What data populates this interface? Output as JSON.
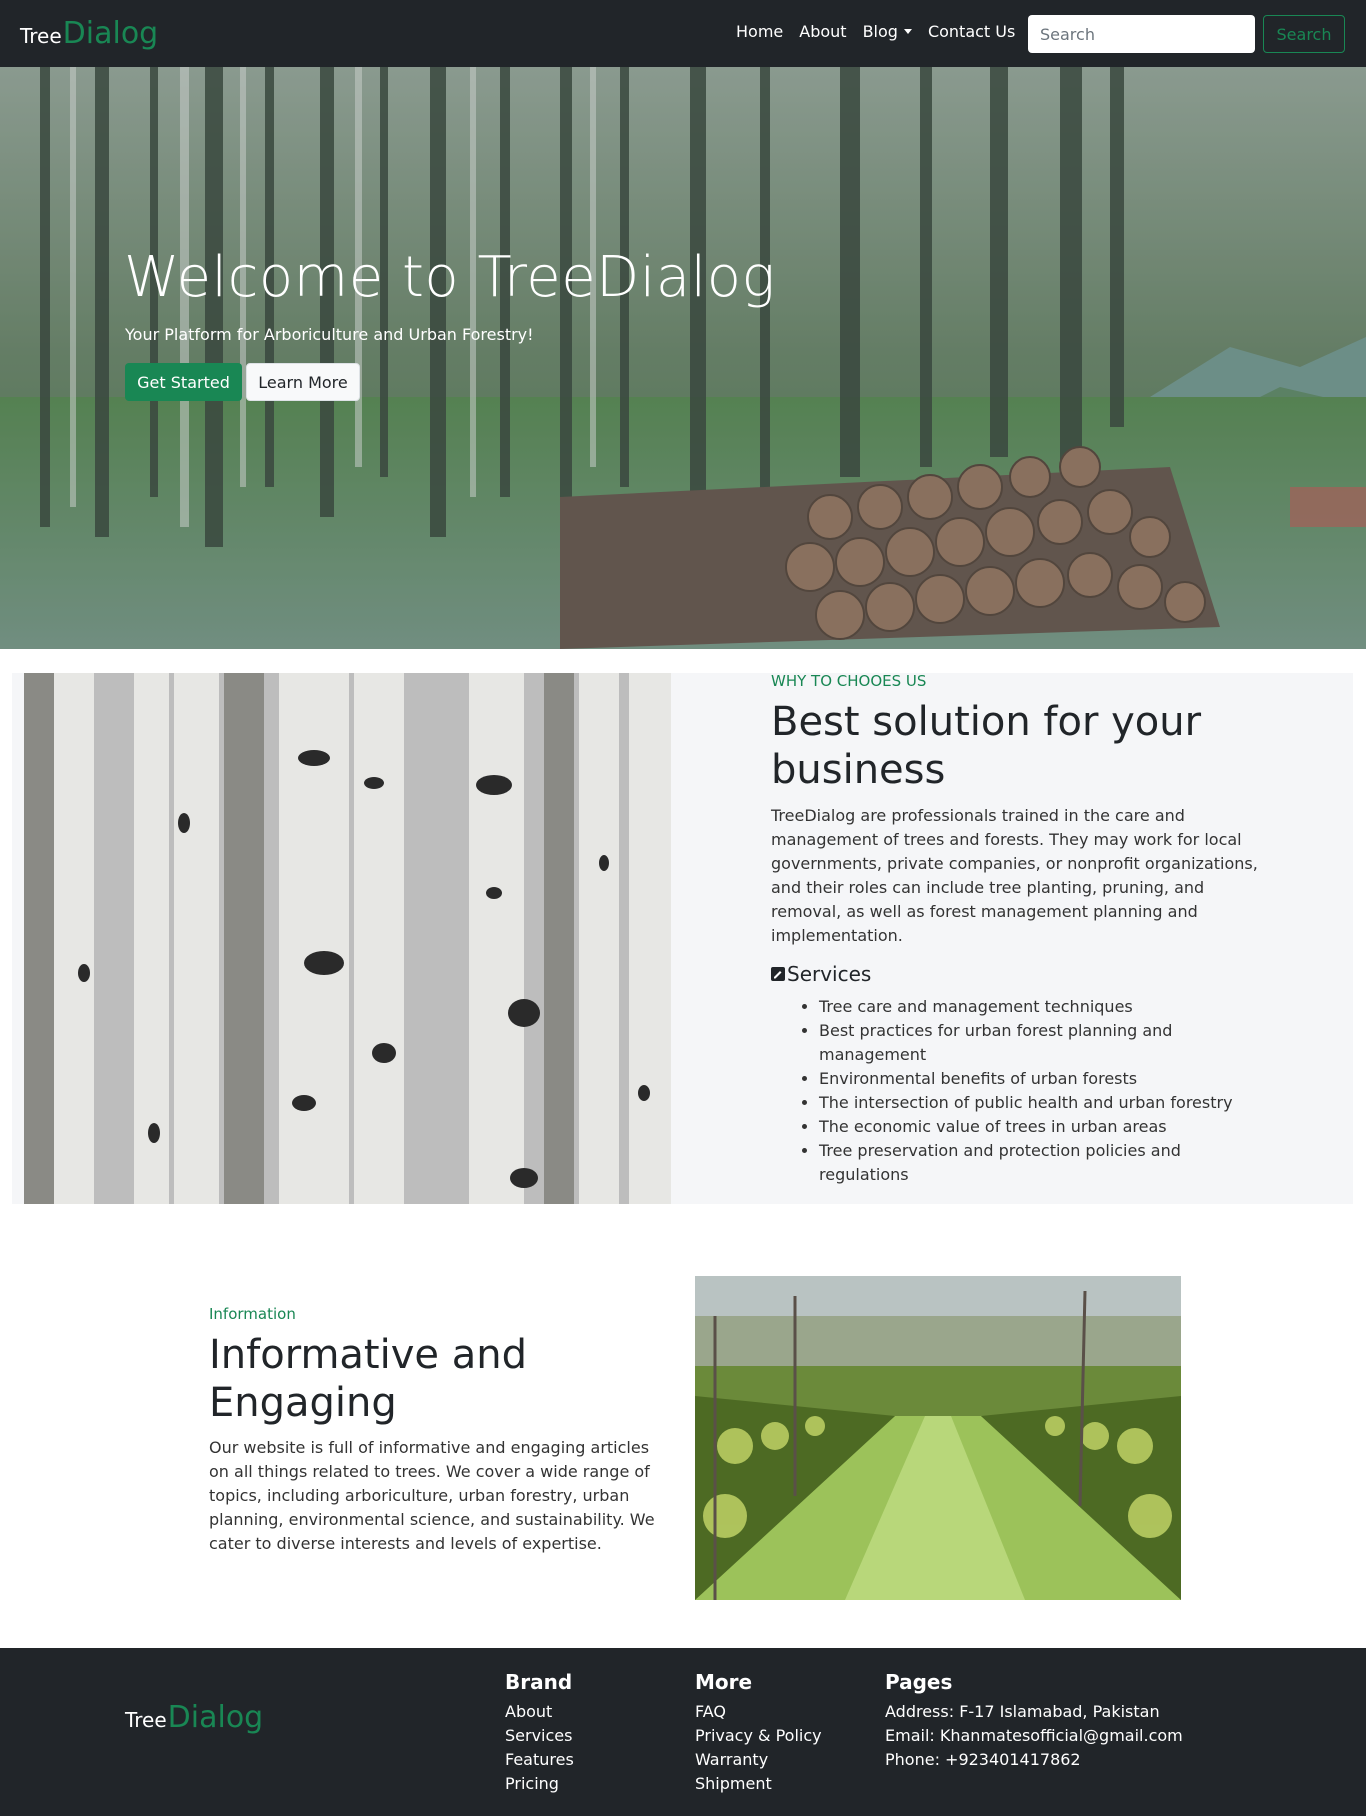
{
  "nav": {
    "brand_part1": "Tree",
    "brand_part2": "Dialog",
    "links": [
      "Home",
      "About",
      "Blog",
      "Contact Us"
    ],
    "search_placeholder": "Search",
    "search_button": "Search"
  },
  "hero": {
    "title": "Welcome to TreeDialog",
    "subtitle": "Your Platform for Arboriculture and Urban Forestry!",
    "primary_button": "Get Started",
    "secondary_button": "Learn More"
  },
  "why": {
    "kicker": "WHY TO CHOOES US",
    "title": "Best solution for your business",
    "text": "TreeDialog are professionals trained in the care and management of trees and forests. They may work for local governments, private companies, or nonprofit organizations, and their roles can include tree planting, pruning, and removal, as well as forest management planning and implementation.",
    "services_title": "Services",
    "services": [
      "Tree care and management techniques",
      "Best practices for urban forest planning and management",
      "Environmental benefits of urban forests",
      "The intersection of public health and urban forestry",
      "The economic value of trees in urban areas",
      "Tree preservation and protection policies and regulations"
    ]
  },
  "info": {
    "kicker": "Information",
    "title": "Informative and Engaging",
    "text": "Our website is full of informative and engaging articles on all things related to trees. We cover a wide range of topics, including arboriculture, urban forestry, urban planning, environmental science, and sustainability. We cater to diverse interests and levels of expertise."
  },
  "footer": {
    "brand_part1": "Tree",
    "brand_part2": "Dialog",
    "brand": {
      "title": "Brand",
      "items": [
        "About",
        "Services",
        "Features",
        "Pricing"
      ]
    },
    "more": {
      "title": "More",
      "items": [
        "FAQ",
        "Privacy & Policy",
        "Warranty",
        "Shipment"
      ]
    },
    "pages": {
      "title": "Pages",
      "items": [
        "Address: F-17 Islamabad, Pakistan",
        "Email: Khanmatesofficial@gmail.com",
        "Phone: +923401417862"
      ]
    }
  },
  "colors": {
    "accent": "#198754",
    "dark": "#212529",
    "light_bg": "#f5f6f8"
  }
}
